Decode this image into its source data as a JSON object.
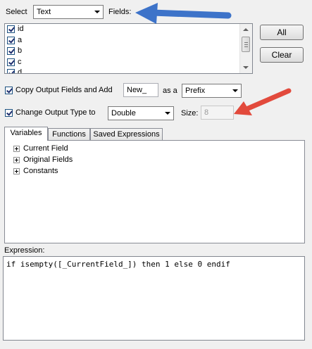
{
  "select_label": "Select",
  "select_value": "Text",
  "fields_label": "Fields:",
  "fields": [
    {
      "label": "id",
      "checked": true
    },
    {
      "label": "a",
      "checked": true
    },
    {
      "label": "b",
      "checked": true
    },
    {
      "label": "c",
      "checked": true
    },
    {
      "label": "d",
      "checked": true
    }
  ],
  "buttons": {
    "all": "All",
    "clear": "Clear"
  },
  "copy_output": {
    "label": "Copy Output Fields and Add",
    "checked": true,
    "value": "New_",
    "as_a": "as a",
    "position": "Prefix"
  },
  "change_type": {
    "label": "Change Output Type to",
    "checked": true,
    "type": "Double",
    "size_label": "Size:",
    "size_value": "8"
  },
  "tabs": [
    "Variables",
    "Functions",
    "Saved Expressions"
  ],
  "tree": [
    "Current Field",
    "Original Fields",
    "Constants"
  ],
  "expression_label": "Expression:",
  "expression": "if isempty([_CurrentField_]) then 1 else 0 endif",
  "colors": {
    "blue_arrow": "#3d73c9",
    "red_arrow": "#e24a3c"
  }
}
